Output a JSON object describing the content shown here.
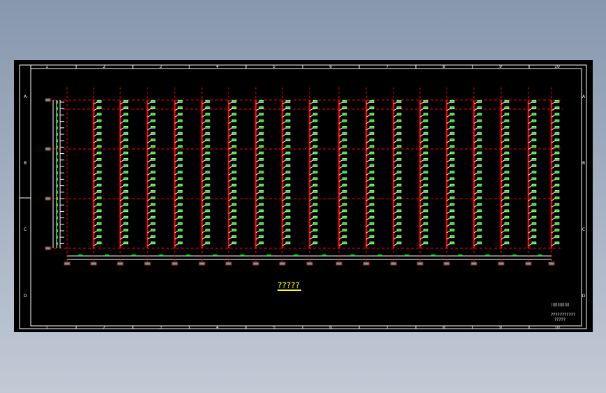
{
  "drawing": {
    "frame_columns": [
      "1",
      "2",
      "3",
      "4",
      "5",
      "6",
      "7",
      "8",
      "9",
      "10"
    ],
    "frame_rows": [
      "A",
      "B",
      "C",
      "D"
    ],
    "title": "?????",
    "note_line1": "???????????",
    "note_line2": "?????",
    "colors": {
      "background": "#000000",
      "frame": "#ffffff",
      "axis": "#ff0000",
      "fixture": "#00ff00",
      "title": "#ffff00"
    }
  }
}
